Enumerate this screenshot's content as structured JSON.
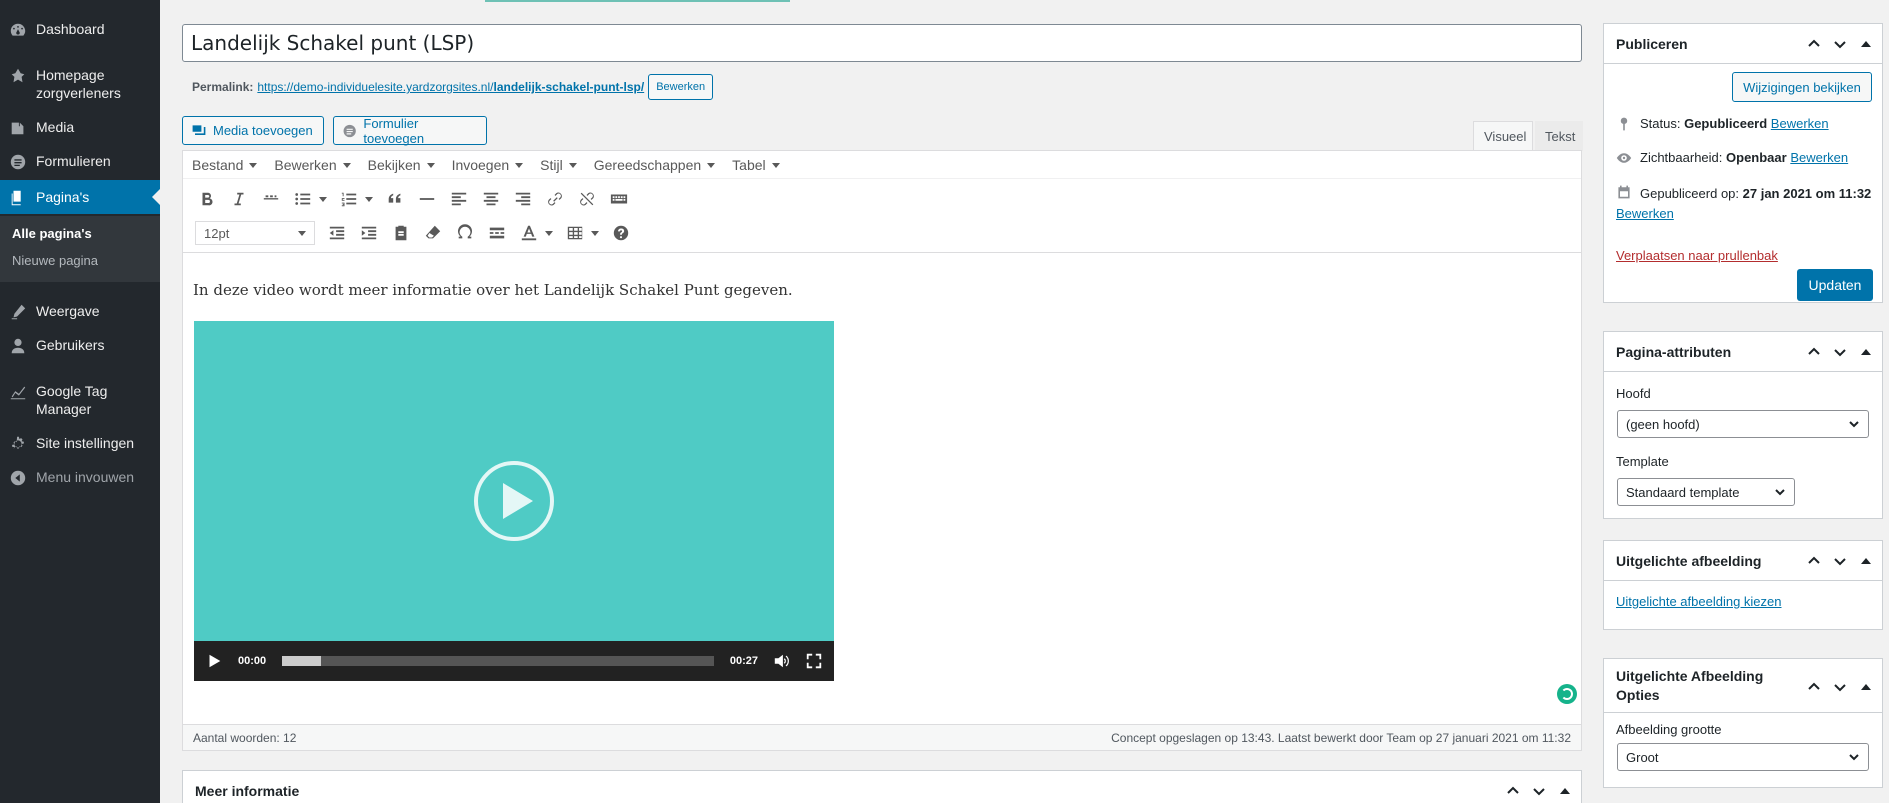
{
  "sidebar": {
    "items": [
      {
        "label": "Dashboard",
        "icon": "dashboard-icon"
      },
      {
        "label": "Homepage zorgverleners",
        "icon": "pin-icon"
      },
      {
        "label": "Media",
        "icon": "media-icon"
      },
      {
        "label": "Formulieren",
        "icon": "forms-icon"
      },
      {
        "label": "Pagina's",
        "icon": "pages-icon"
      },
      {
        "label": "Weergave",
        "icon": "appearance-icon"
      },
      {
        "label": "Gebruikers",
        "icon": "users-icon"
      },
      {
        "label": "Google Tag Manager",
        "icon": "chart-icon"
      },
      {
        "label": "Site instellingen",
        "icon": "gear-icon"
      },
      {
        "label": "Menu invouwen",
        "icon": "collapse-icon"
      }
    ],
    "submenu": [
      "Alle pagina's",
      "Nieuwe pagina"
    ]
  },
  "editor": {
    "title": "Landelijk Schakel punt (LSP)",
    "permalink_label": "Permalink:",
    "permalink_base": "https://demo-individuelesite.yardzorgsites.nl/",
    "permalink_slug": "landelijk-schakel-punt-lsp/",
    "permalink_edit": "Bewerken",
    "add_media": "Media toevoegen",
    "add_form": "Formulier toevoegen",
    "tab_visual": "Visueel",
    "tab_text": "Tekst",
    "menubar": [
      "Bestand",
      "Bewerken",
      "Bekijken",
      "Invoegen",
      "Stijl",
      "Gereedschappen",
      "Tabel"
    ],
    "font_size": "12pt",
    "content_text": "In deze video wordt meer informatie over het Landelijk Schakel Punt gegeven.",
    "video": {
      "current_time": "00:00",
      "duration": "00:27",
      "progress": 0.09
    },
    "word_count": "Aantal woorden: 12",
    "save_status": "Concept opgeslagen op 13:43. Laatst bewerkt door Team op 27 januari 2021 om 11:32"
  },
  "meer_info": {
    "title": "Meer informatie"
  },
  "publish": {
    "title": "Publiceren",
    "preview": "Wijzigingen bekijken",
    "status_label": "Status:",
    "status_value": "Gepubliceerd",
    "visibility_label": "Zichtbaarheid:",
    "visibility_value": "Openbaar",
    "published_label": "Gepubliceerd op:",
    "published_value": "27 jan 2021 om 11:32",
    "edit": "Bewerken",
    "trash": "Verplaatsen naar prullenbak",
    "update": "Updaten"
  },
  "attributes": {
    "title": "Pagina-attributen",
    "parent_label": "Hoofd",
    "parent_value": "(geen hoofd)",
    "template_label": "Template",
    "template_value": "Standaard template"
  },
  "featured": {
    "title": "Uitgelichte afbeelding",
    "link": "Uitgelichte afbeelding kiezen"
  },
  "featured_opts": {
    "title": "Uitgelichte Afbeelding Opties",
    "size_label": "Afbeelding grootte",
    "size_value": "Groot"
  },
  "colors": {
    "accent": "#0073aa",
    "sidebar": "#23282d",
    "video": "#4fcbc5"
  }
}
